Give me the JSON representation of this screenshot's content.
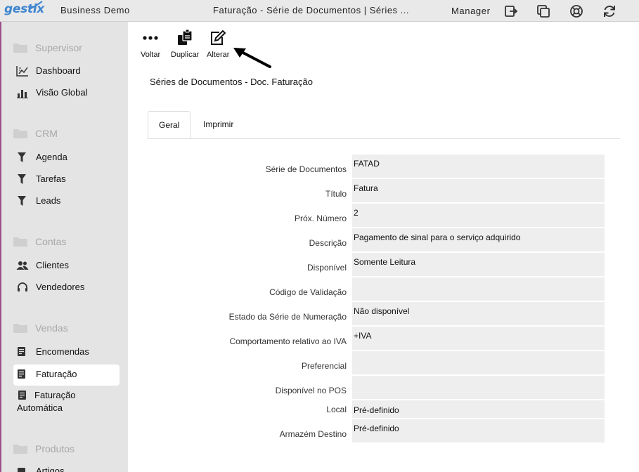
{
  "topbar": {
    "logo": "gestix",
    "company": "Business Demo",
    "window_title": "Faturação - Série de Documentos | Séries ...",
    "user": "Manager",
    "icons": [
      "logout-icon",
      "windows-icon",
      "help-lifebuoy-icon",
      "refresh-icon"
    ]
  },
  "sidebar": {
    "sections": [
      {
        "title": "Supervisor",
        "items": [
          {
            "label": "Dashboard",
            "icon": "dashboard-icon"
          },
          {
            "label": "Visão Global",
            "icon": "bar-chart-icon"
          }
        ]
      },
      {
        "title": "CRM",
        "items": [
          {
            "label": "Agenda",
            "icon": "funnel-icon"
          },
          {
            "label": "Tarefas",
            "icon": "funnel-icon"
          },
          {
            "label": "Leads",
            "icon": "funnel-icon"
          }
        ]
      },
      {
        "title": "Contas",
        "items": [
          {
            "label": "Clientes",
            "icon": "users-icon"
          },
          {
            "label": "Vendedores",
            "icon": "headset-icon"
          }
        ]
      },
      {
        "title": "Vendas",
        "items": [
          {
            "label": "Encomendas",
            "icon": "document-icon"
          },
          {
            "label": "Faturação",
            "icon": "document-icon",
            "active": true
          },
          {
            "label_line1": "Faturação",
            "label_line2": "Automática",
            "icon": "document-icon"
          }
        ]
      },
      {
        "title": "Produtos",
        "items": [
          {
            "label": "Artigos",
            "icon": "document-icon"
          }
        ]
      }
    ]
  },
  "toolbar": {
    "back_label": "Voltar",
    "duplicate_label": "Duplicar",
    "edit_label": "Alterar"
  },
  "page_title": "Séries de Documentos - Doc. Faturação",
  "tabs": [
    {
      "label": "Geral",
      "active": true
    },
    {
      "label": "Imprimir",
      "active": false
    }
  ],
  "form": {
    "rows": [
      {
        "label": "Série de Documentos",
        "value": "FATAD"
      },
      {
        "label": "Título",
        "value": "Fatura"
      },
      {
        "label": "Próx. Número",
        "value": "2"
      },
      {
        "label": "Descrição",
        "value": "Pagamento de sinal para o serviço adquirido"
      },
      {
        "label": "Disponível",
        "value": "Somente Leitura"
      },
      {
        "label": "Código de Validação",
        "value": ""
      },
      {
        "label": "Estado da Série de Numeração",
        "value": "Não disponível"
      },
      {
        "label": "Comportamento relativo ao IVA",
        "value": "+IVA"
      },
      {
        "label": "Preferencial",
        "value": ""
      },
      {
        "label": "Disponível no POS",
        "value": ""
      },
      {
        "label": "Local",
        "value": "Pré-definido"
      },
      {
        "label": "Armazém Destino",
        "value": "Pré-definido"
      }
    ]
  },
  "colors": {
    "brand": "#3f86cf",
    "sidebar_bg": "#e4e4e4",
    "field_bg": "#eeeeee",
    "accent_stripe": "#9b4f8a"
  }
}
